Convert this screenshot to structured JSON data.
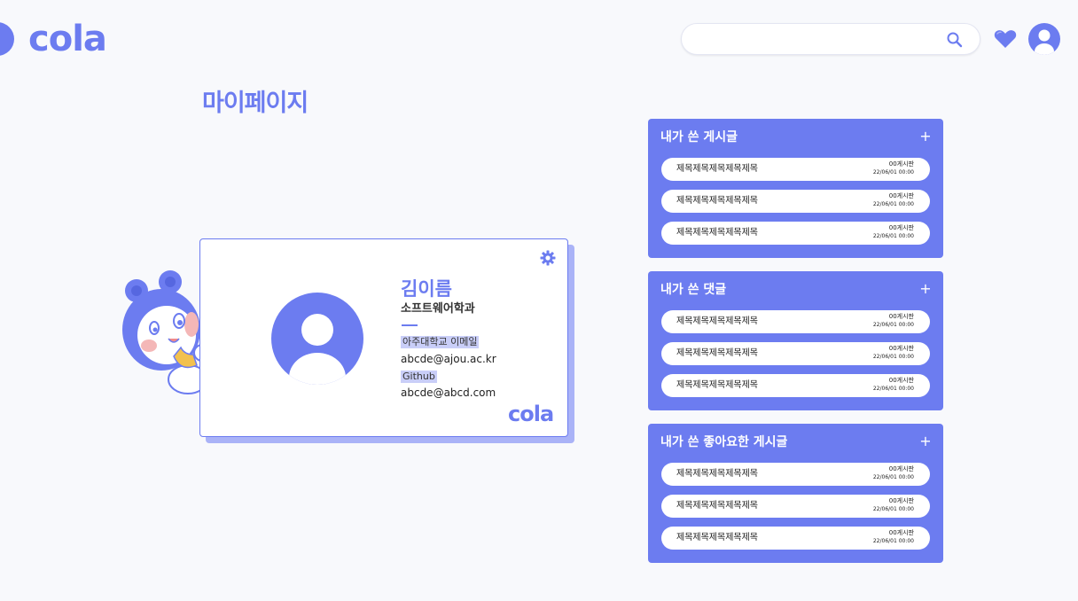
{
  "header": {
    "logo": "cola",
    "search": {
      "value": "",
      "placeholder": ""
    },
    "icons": [
      "search-icon",
      "heart-icon",
      "user-icon"
    ]
  },
  "page": {
    "title": "마이페이지"
  },
  "profile": {
    "name": "김이름",
    "department": "소프트웨어학과",
    "email_label": "아주대학교 이메일",
    "email": "abcde@ajou.ac.kr",
    "github_label": "Github",
    "github": "abcde@abcd.com",
    "card_logo": "cola",
    "settings_icon": "gear-icon"
  },
  "panels": [
    {
      "title": "내가 쓴 게시글",
      "add_label": "+",
      "items": [
        {
          "title": "제목제목제목제목제목",
          "board": "00게시판",
          "date": "22/06/01 00:00"
        },
        {
          "title": "제목제목제목제목제목",
          "board": "00게시판",
          "date": "22/06/01 00:00"
        },
        {
          "title": "제목제목제목제목제목",
          "board": "00게시판",
          "date": "22/06/01 00:00"
        }
      ]
    },
    {
      "title": "내가 쓴 댓글",
      "add_label": "+",
      "items": [
        {
          "title": "제목제목제목제목제목",
          "board": "00게시판",
          "date": "22/06/01 00:00"
        },
        {
          "title": "제목제목제목제목제목",
          "board": "00게시판",
          "date": "22/06/01 00:00"
        },
        {
          "title": "제목제목제목제목제목",
          "board": "00게시판",
          "date": "22/06/01 00:00"
        }
      ]
    },
    {
      "title": "내가 쓴 좋아요한 게시글",
      "add_label": "+",
      "items": [
        {
          "title": "제목제목제목제목제목",
          "board": "00게시판",
          "date": "22/06/01 00:00"
        },
        {
          "title": "제목제목제목제목제목",
          "board": "00게시판",
          "date": "22/06/01 00:00"
        },
        {
          "title": "제목제목제목제목제목",
          "board": "00게시판",
          "date": "22/06/01 00:00"
        }
      ]
    }
  ],
  "colors": {
    "accent": "#6c7cf0",
    "highlight": "#c9cef8",
    "background": "#f8f9fc"
  }
}
